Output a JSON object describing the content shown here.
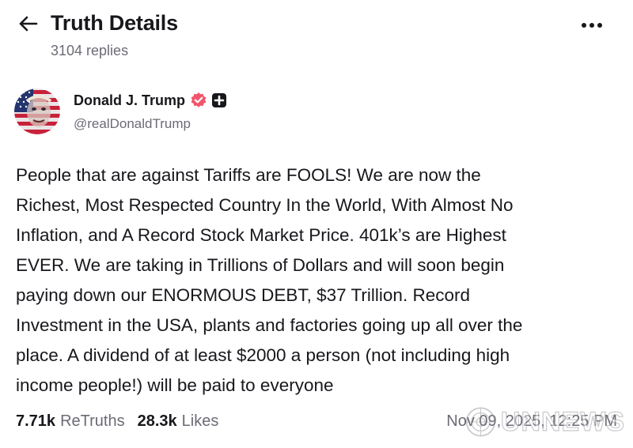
{
  "header": {
    "back_icon": "arrow-left-icon",
    "title": "Truth Details",
    "replies": "3104 replies",
    "more_icon": "more-horizontal-icon"
  },
  "author": {
    "avatar_icon": "avatar-flag-portrait",
    "display_name": "Donald J. Trump",
    "verified_icon": "verified-badge-icon",
    "verified_color": "#f1556c",
    "plus_icon": "plus-badge-icon",
    "handle": "@realDonaldTrump"
  },
  "post": {
    "text": "People that are against Tariffs are FOOLS! We are now the\nRichest, Most Respected Country In the World, With Almost No\nInflation, and A Record Stock Market Price. 401k’s are Highest\nEVER. We are taking in Trillions of Dollars and will soon begin\npaying down our ENORMOUS DEBT, $37 Trillion. Record\nInvestment in the USA, plants and factories going up all over the\nplace. A dividend of at least $2000 a person (not including high\nincome people!) will be paid to everyone"
  },
  "stats": {
    "retruths_count": "7.71k",
    "retruths_label": "ReTruths",
    "likes_count": "28.3k",
    "likes_label": "Likes",
    "timestamp": "Nov 09, 2025, 12:25 PM"
  },
  "watermark": {
    "text": "UNNEWS",
    "icon": "un-globe-icon"
  },
  "colors": {
    "text": "#17171c",
    "muted": "#6b6b76",
    "background": "#ffffff"
  }
}
